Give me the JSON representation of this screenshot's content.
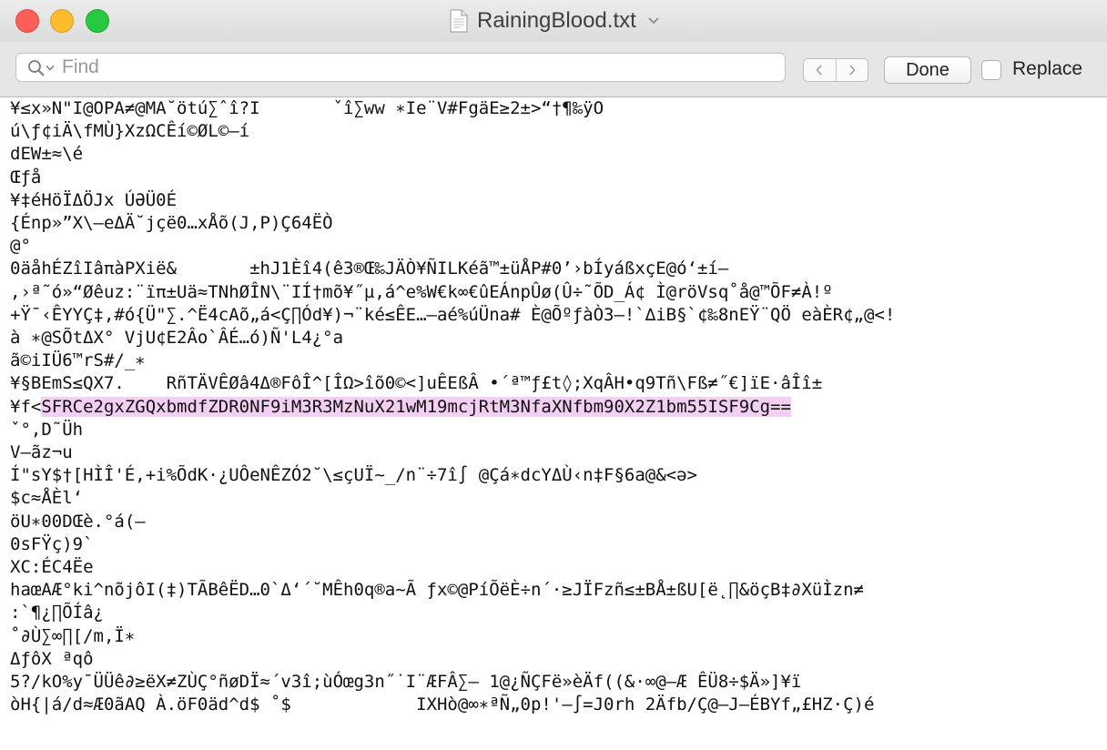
{
  "window": {
    "title": "RainingBlood.txt"
  },
  "findbar": {
    "search_placeholder": "Find",
    "search_value": "",
    "done_label": "Done",
    "replace_label": "Replace",
    "replace_checked": false
  },
  "document": {
    "lines": [
      {
        "pre": "¥≤x»N\"I@OPA≠@MA˘ötú∑ˆî?I       ˇî∑ww ∗Ie¨V#FgäE≥2±>“†¶‰ÿO",
        "hl": "",
        "post": ""
      },
      {
        "pre": "ú\\ƒ¢iÄ\\fMÙ}XzΩCÊí©ØL©–í",
        "hl": "",
        "post": ""
      },
      {
        "pre": "dEW±≈\\é",
        "hl": "",
        "post": ""
      },
      {
        "pre": "Œƒå",
        "hl": "",
        "post": ""
      },
      {
        "pre": "¥‡éHöÏΔÖJx ÚƏÜ0É",
        "hl": "",
        "post": ""
      },
      {
        "pre": "{Énp»”X\\—eΔÄ˘jçë0…xÅõ(J,P)Ç64ËÒ",
        "hl": "",
        "post": ""
      },
      {
        "pre": "@°",
        "hl": "",
        "post": ""
      },
      {
        "pre": "0äåhÉZîIâπàPXië&       ±hJ1Èî4(ê3®Œ‰JÄÒ¥ÑILKéã™±üÅP#0’›bÍyáßxçE@ó‘±í—",
        "hl": "",
        "post": ""
      },
      {
        "pre": ",›ª˜ó»“Øêuz:¨ïπ±Uä≈TNhØÎN\\¨IÍ†mõ¥˝µ,á^e%W€k∞€ûEÁnpÛø(Û÷˜ÕD_Á¢ Ì@röVsq˚å@™ÕF≠À!º",
        "hl": "",
        "post": ""
      },
      {
        "pre": "+Ÿ¯‹ÊYYÇ‡,#ó{Ü\"∑.^Ë4cAõ„á<Ç∏Ód¥)¬¨ké≤ÊE…–aé%úÜna# È@ÕºƒàÒ3–!`∆iB§`¢‰8nEŸ¨QÖ eàÈR¢„@<!",
        "hl": "",
        "post": ""
      },
      {
        "pre": "à ∗@SÕtΔX° VjU¢E2Âo`ÂÉ…ó)Ñ'L4¿°a",
        "hl": "",
        "post": ""
      },
      {
        "pre": "ã©iIÜ6™rS#/_∗",
        "hl": "",
        "post": ""
      },
      {
        "pre": "¥§BEmS≤QX7.    RñTÄVÊØâ4Δ®FôÎ^[ÎΩ>îõ0©<]uÊEßÂ •´ª™ƒ£t◊;XqÂH•q9Tñ\\Fß≠˝€]ïE·âÎî±",
        "hl": "",
        "post": ""
      },
      {
        "pre": "¥f<",
        "hl": "SFRCe2gxZGQxbmdfZDR0NF9iM3R3MzNuX21wM19mcjRtM3NfaXNfbm90X2Z1bm55ISF9Cg==",
        "post": ""
      },
      {
        "pre": "ˇ°,D˜Üh",
        "hl": "",
        "post": ""
      },
      {
        "pre": "V–ãz¬u",
        "hl": "",
        "post": ""
      },
      {
        "pre": "Í\"sY$†[HÌÎ'É,+i%ÕdK·¿UÔeNÊZÓ2˘\\≤çUÏ~_/n¨÷7î∫ @Çá∗dcYΔÙ‹n‡F§6a@&<ə>",
        "hl": "",
        "post": ""
      },
      {
        "pre": "$c≈ÅÈl‘",
        "hl": "",
        "post": ""
      },
      {
        "pre": "öU∗00DŒè.°á(—",
        "hl": "",
        "post": ""
      },
      {
        "pre": "0sFŸç)9`",
        "hl": "",
        "post": ""
      },
      {
        "pre": "XC:ÉC4Ëe",
        "hl": "",
        "post": ""
      },
      {
        "pre": "haœAÆ°ki^nõjôI(‡)TÃBêËD…0`Δ‘´˘MÊh0q®a~Ã ƒx©@PíÕëÈ÷n´·≥JÏFzñ≤±BÅ±ßU[ë˛∏&öçB‡∂XüÌzn≠",
        "hl": "",
        "post": ""
      },
      {
        "pre": ":`¶¿∏ÕÍâ¿",
        "hl": "",
        "post": ""
      },
      {
        "pre": "˚∂Ù∑∞∏[/m,Ï∗",
        "hl": "",
        "post": ""
      },
      {
        "pre": "ΔƒôX ªqô",
        "hl": "",
        "post": ""
      },
      {
        "pre": "5?/kO%y¯ÜÜê∂≥ëX≠ZÙÇ°ñøDÏ≈´v3î;ùÓœg3n˝˙I¨ÆFÂ∑– 1@¿ÑÇFë»èÄf((&·∞@–Æ ÊÜ8÷$Ä»]¥ï",
        "hl": "",
        "post": ""
      },
      {
        "pre": "òH{|á/d≈Æ0ãAQ À.öF0äd^d$ ˚$            IXHò@∞∗ªÑ„0p!'–∫=J0rh 2Äfb/Ç@–J–ÉBYf„£HZ·Ç)é",
        "hl": "",
        "post": ""
      }
    ]
  }
}
